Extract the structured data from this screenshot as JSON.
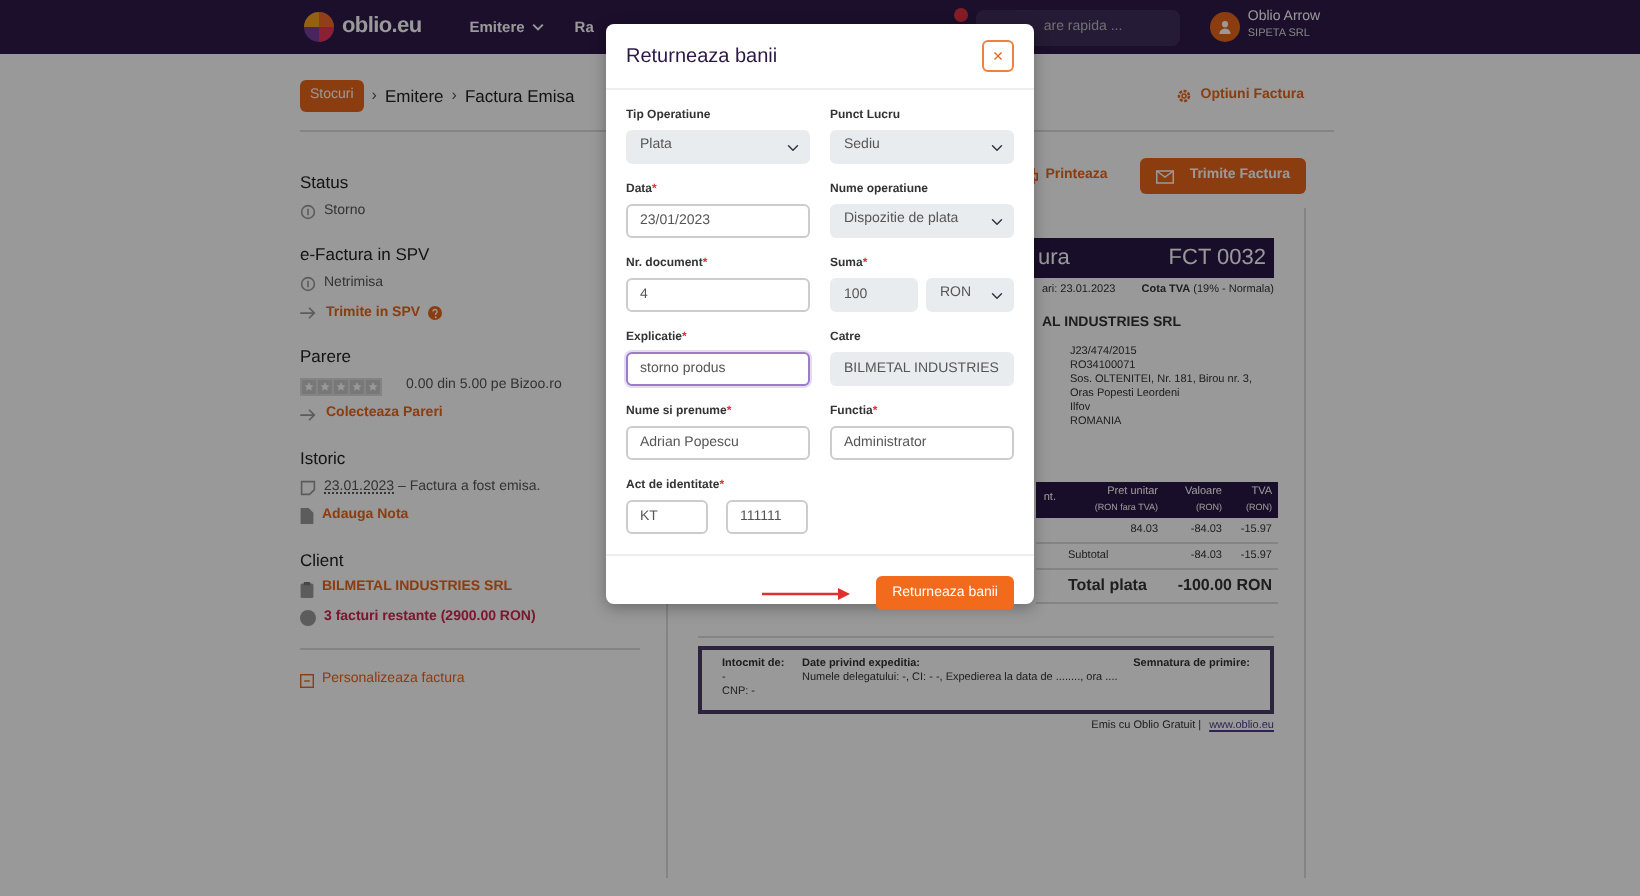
{
  "navbar": {
    "logo": "oblio.eu",
    "menu": [
      {
        "label": "Emitere",
        "caret": true
      },
      {
        "label": "Ra",
        "caret": false
      }
    ],
    "notification_badge": true,
    "search": {
      "placeholder": "are rapida ..."
    },
    "user": {
      "name": "Oblio Arrow",
      "company": "SIPETA SRL"
    }
  },
  "breadcrumb": {
    "separator": "›",
    "items": [
      {
        "label": "Stocuri",
        "kind": "badge"
      },
      {
        "label": "Emitere",
        "kind": "text"
      },
      {
        "label": "Factura Emisa",
        "kind": "text"
      }
    ]
  },
  "options_link": "Optiuni Factura",
  "sidebar": {
    "sections": [
      {
        "title": "Status",
        "items": [
          {
            "kind": "info",
            "text": "Storno"
          }
        ]
      },
      {
        "title": "e-Factura in SPV",
        "items": [
          {
            "kind": "info",
            "text": "Netrimisa"
          },
          {
            "kind": "action",
            "text": "Trimite in SPV",
            "help": true
          }
        ]
      },
      {
        "title": "Parere",
        "items": [
          {
            "kind": "rating",
            "stars": 0,
            "text": "0.00 din 5.00 pe Bizoo.ro"
          },
          {
            "kind": "action",
            "text": "Colecteaza Pareri",
            "help": false
          }
        ]
      },
      {
        "title": "Istoric",
        "items": [
          {
            "kind": "history",
            "date": "23.01.2023",
            "text": " – Factura a fost emisa."
          },
          {
            "kind": "note",
            "text": "Adauga Nota"
          }
        ]
      },
      {
        "title": "Client",
        "items": [
          {
            "kind": "client",
            "text": "BILMETAL INDUSTRIES SRL"
          },
          {
            "kind": "debt",
            "text": "3 facturi restante (2900.00 RON)"
          }
        ]
      }
    ],
    "customize": "Personalizeaza factura"
  },
  "actions": [
    {
      "label": "Printeaza",
      "kind": "link"
    },
    {
      "label": "Trimite Factura",
      "kind": "primary"
    }
  ],
  "invoice": {
    "title": "ura",
    "number": "FCT 0032",
    "date": "ari: 23.01.2023",
    "vat": "**Cota TVA** (19% - Normala)",
    "client_name": "AL INDUSTRIES SRL",
    "client_details": [
      "J23/474/2015",
      "RO34100071",
      "Sos. OLTENITEI, Nr. 181, Birou nr. 3, Oras Popesti Leordeni",
      "Ilfov",
      "ROMANIA"
    ],
    "columns": [
      {
        "title": "nt."
      },
      {
        "title": "Pret unitar",
        "subtitle": "(RON fara TVA)"
      },
      {
        "title": "Valoare",
        "subtitle": "(RON)"
      },
      {
        "title": "TVA",
        "subtitle": "(RON)"
      }
    ],
    "rows": [
      {
        "cells": [
          "",
          "84.03",
          "-84.03",
          "-15.97"
        ]
      }
    ],
    "subtotal": {
      "label": "Subtotal",
      "values": [
        "-84.03",
        "-15.97"
      ]
    },
    "total": {
      "label": "Total plata",
      "value": "-100.00 RON"
    },
    "footer": {
      "issued_title": "Intocmit de:",
      "issued_lines": [
        "-",
        "CNP: -"
      ],
      "shipping_title": "Date privind expeditia:",
      "shipping_text": "Numele delegatului: -, CI: - -, Expedierea la data de ........, ora ....",
      "signature": "Semnatura de primire:"
    },
    "credit": {
      "text": "Emis cu Oblio Gratuit |",
      "link": "www.oblio.eu"
    }
  },
  "modal": {
    "title": "Returneaza banii",
    "close": "×",
    "submit": "Returneaza banii",
    "fields": [
      {
        "label": "Tip Operatiune",
        "kind": "select",
        "value": "Plata",
        "disabled": true,
        "focused": false
      },
      {
        "label": "Punct Lucru",
        "kind": "select",
        "value": "Sediu",
        "disabled": true,
        "focused": false
      },
      {
        "label": "Data",
        "required_mark": "*",
        "kind": "input",
        "value": "23/01/2023",
        "disabled": false,
        "focused": false
      },
      {
        "label": "Nume operatiune",
        "kind": "select",
        "value": "Dispozitie de plata",
        "disabled": true,
        "focused": false
      },
      {
        "label": "Nr. document",
        "required_mark": "*",
        "kind": "input",
        "value": "4",
        "disabled": false,
        "focused": false
      },
      {
        "label": "Suma",
        "required_mark": "*",
        "kind": "amount",
        "value": "100",
        "currency": "RON",
        "disabled": true,
        "focused": false
      },
      {
        "label": "Explicatie",
        "required_mark": "*",
        "kind": "input",
        "value": "storno produs",
        "disabled": false,
        "focused": true
      },
      {
        "label": "Catre",
        "kind": "input",
        "value": "BILMETAL INDUSTRIES",
        "disabled": true,
        "focused": false
      },
      {
        "label": "Nume si prenume",
        "required_mark": "*",
        "kind": "input",
        "value": "Adrian Popescu",
        "disabled": false,
        "focused": false
      },
      {
        "label": "Functia",
        "required_mark": "*",
        "kind": "input",
        "value": "Administrator",
        "disabled": false,
        "focused": false
      },
      {
        "label": "Act de identitate",
        "required_mark": "*",
        "kind": "id",
        "value": "KT",
        "number": "111111",
        "disabled": false,
        "focused": false
      }
    ]
  }
}
